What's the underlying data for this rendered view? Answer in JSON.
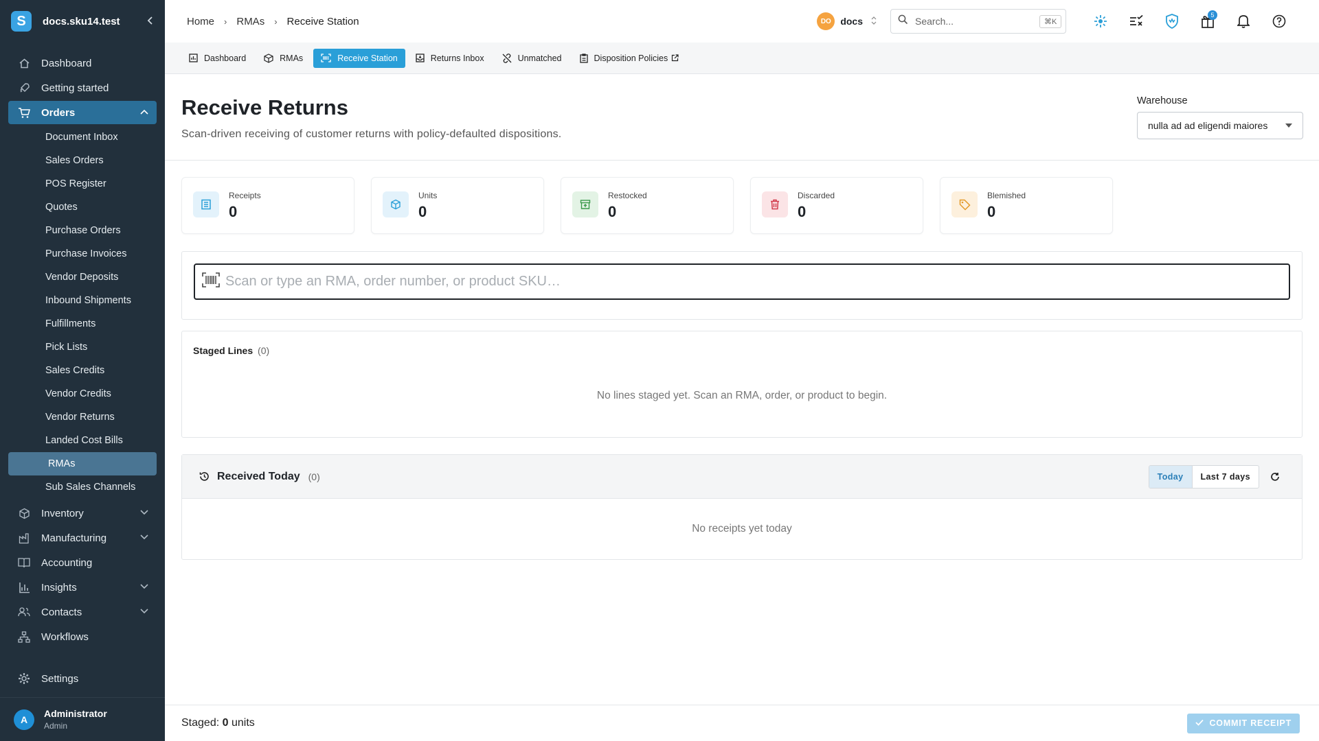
{
  "app": {
    "workspace": "docs.sku14.test",
    "brand_letter": "S"
  },
  "sidebar": {
    "items": [
      {
        "label": "Dashboard",
        "icon": "home-icon"
      },
      {
        "label": "Getting started",
        "icon": "rocket-icon"
      },
      {
        "label": "Orders",
        "icon": "cart-icon"
      },
      {
        "label": "Inventory",
        "icon": "box-icon"
      },
      {
        "label": "Manufacturing",
        "icon": "factory-icon"
      },
      {
        "label": "Accounting",
        "icon": "book-icon"
      },
      {
        "label": "Insights",
        "icon": "bar-chart-icon"
      },
      {
        "label": "Contacts",
        "icon": "contacts-icon"
      },
      {
        "label": "Workflows",
        "icon": "workflow-icon"
      },
      {
        "label": "Settings",
        "icon": "gear-icon"
      }
    ],
    "orders_sub": [
      "Document Inbox",
      "Sales Orders",
      "POS Register",
      "Quotes",
      "Purchase Orders",
      "Purchase Invoices",
      "Vendor Deposits",
      "Inbound Shipments",
      "Fulfillments",
      "Pick Lists",
      "Sales Credits",
      "Vendor Credits",
      "Vendor Returns",
      "Landed Cost Bills",
      "RMAs",
      "Sub Sales Channels"
    ],
    "user": {
      "name": "Administrator",
      "role": "Admin",
      "initial": "A"
    }
  },
  "breadcrumb": [
    "Home",
    "RMAs",
    "Receive Station"
  ],
  "org": {
    "badge": "DO",
    "name": "docs"
  },
  "search": {
    "placeholder": "Search...",
    "shortcut": "⌘K"
  },
  "notifications": {
    "gift_count": "5"
  },
  "tabs": [
    "Dashboard",
    "RMAs",
    "Receive Station",
    "Returns Inbox",
    "Unmatched",
    "Disposition Policies"
  ],
  "header": {
    "title": "Receive Returns",
    "subtitle": "Scan-driven receiving of customer returns with policy-defaulted dispositions.",
    "warehouse_label": "Warehouse",
    "warehouse_value": "nulla ad ad eligendi maiores"
  },
  "stats": [
    {
      "label": "Receipts",
      "value": "0",
      "color": "#2a9fd8",
      "bg": "#e3f2fb"
    },
    {
      "label": "Units",
      "value": "0",
      "color": "#2a9fd8",
      "bg": "#e3f2fb"
    },
    {
      "label": "Restocked",
      "value": "0",
      "color": "#3a9a4a",
      "bg": "#e3f3e5"
    },
    {
      "label": "Discarded",
      "value": "0",
      "color": "#d23a4a",
      "bg": "#fbe4e6"
    },
    {
      "label": "Blemished",
      "value": "0",
      "color": "#e39a2a",
      "bg": "#fdf0dd"
    }
  ],
  "scan": {
    "placeholder": "Scan or type an RMA, order number, or product SKU…"
  },
  "staged_lines": {
    "title": "Staged Lines",
    "count": "(0)",
    "empty": "No lines staged yet. Scan an RMA, order, or product to begin."
  },
  "received_today": {
    "title": "Received Today",
    "count": "(0)",
    "filters": [
      "Today",
      "Last 7 days"
    ],
    "empty": "No receipts yet today"
  },
  "footer": {
    "staged_prefix": "Staged:",
    "staged_count": "0",
    "staged_suffix": "units",
    "commit_label": "COMMIT RECEIPT"
  }
}
